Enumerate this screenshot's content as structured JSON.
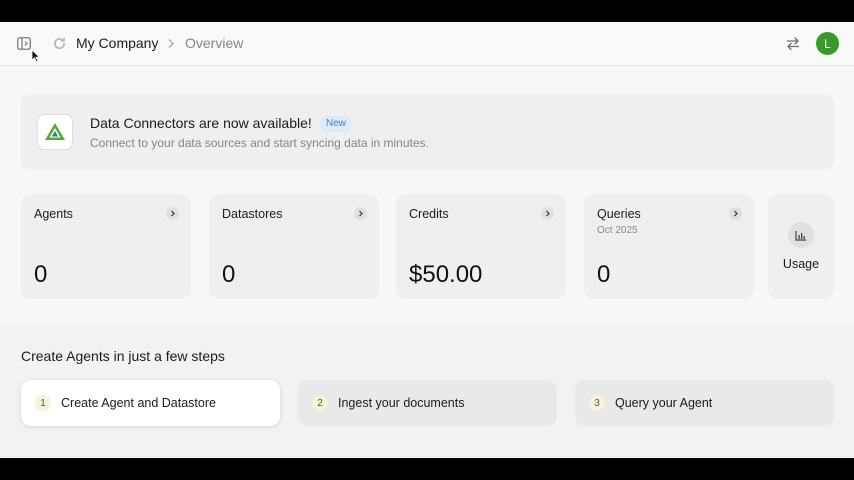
{
  "header": {
    "company": "My Company",
    "breadcrumb_current": "Overview",
    "avatar_initial": "L",
    "avatar_color": "#3a9a29"
  },
  "banner": {
    "title": "Data Connectors are now available!",
    "badge": "New",
    "subtitle": "Connect to your data sources and start syncing data in minutes."
  },
  "stats": [
    {
      "label": "Agents",
      "sub": "",
      "value": "0"
    },
    {
      "label": "Datastores",
      "sub": "",
      "value": "0"
    },
    {
      "label": "Credits",
      "sub": "",
      "value": "$50.00"
    },
    {
      "label": "Queries",
      "sub": "Oct 2025",
      "value": "0"
    }
  ],
  "usage": {
    "label": "Usage",
    "icon": "bar-chart-icon"
  },
  "steps": {
    "title": "Create Agents in just a few steps",
    "items": [
      {
        "num": "1",
        "label": "Create Agent and Datastore"
      },
      {
        "num": "2",
        "label": "Ingest your documents"
      },
      {
        "num": "3",
        "label": "Query your Agent"
      }
    ]
  }
}
